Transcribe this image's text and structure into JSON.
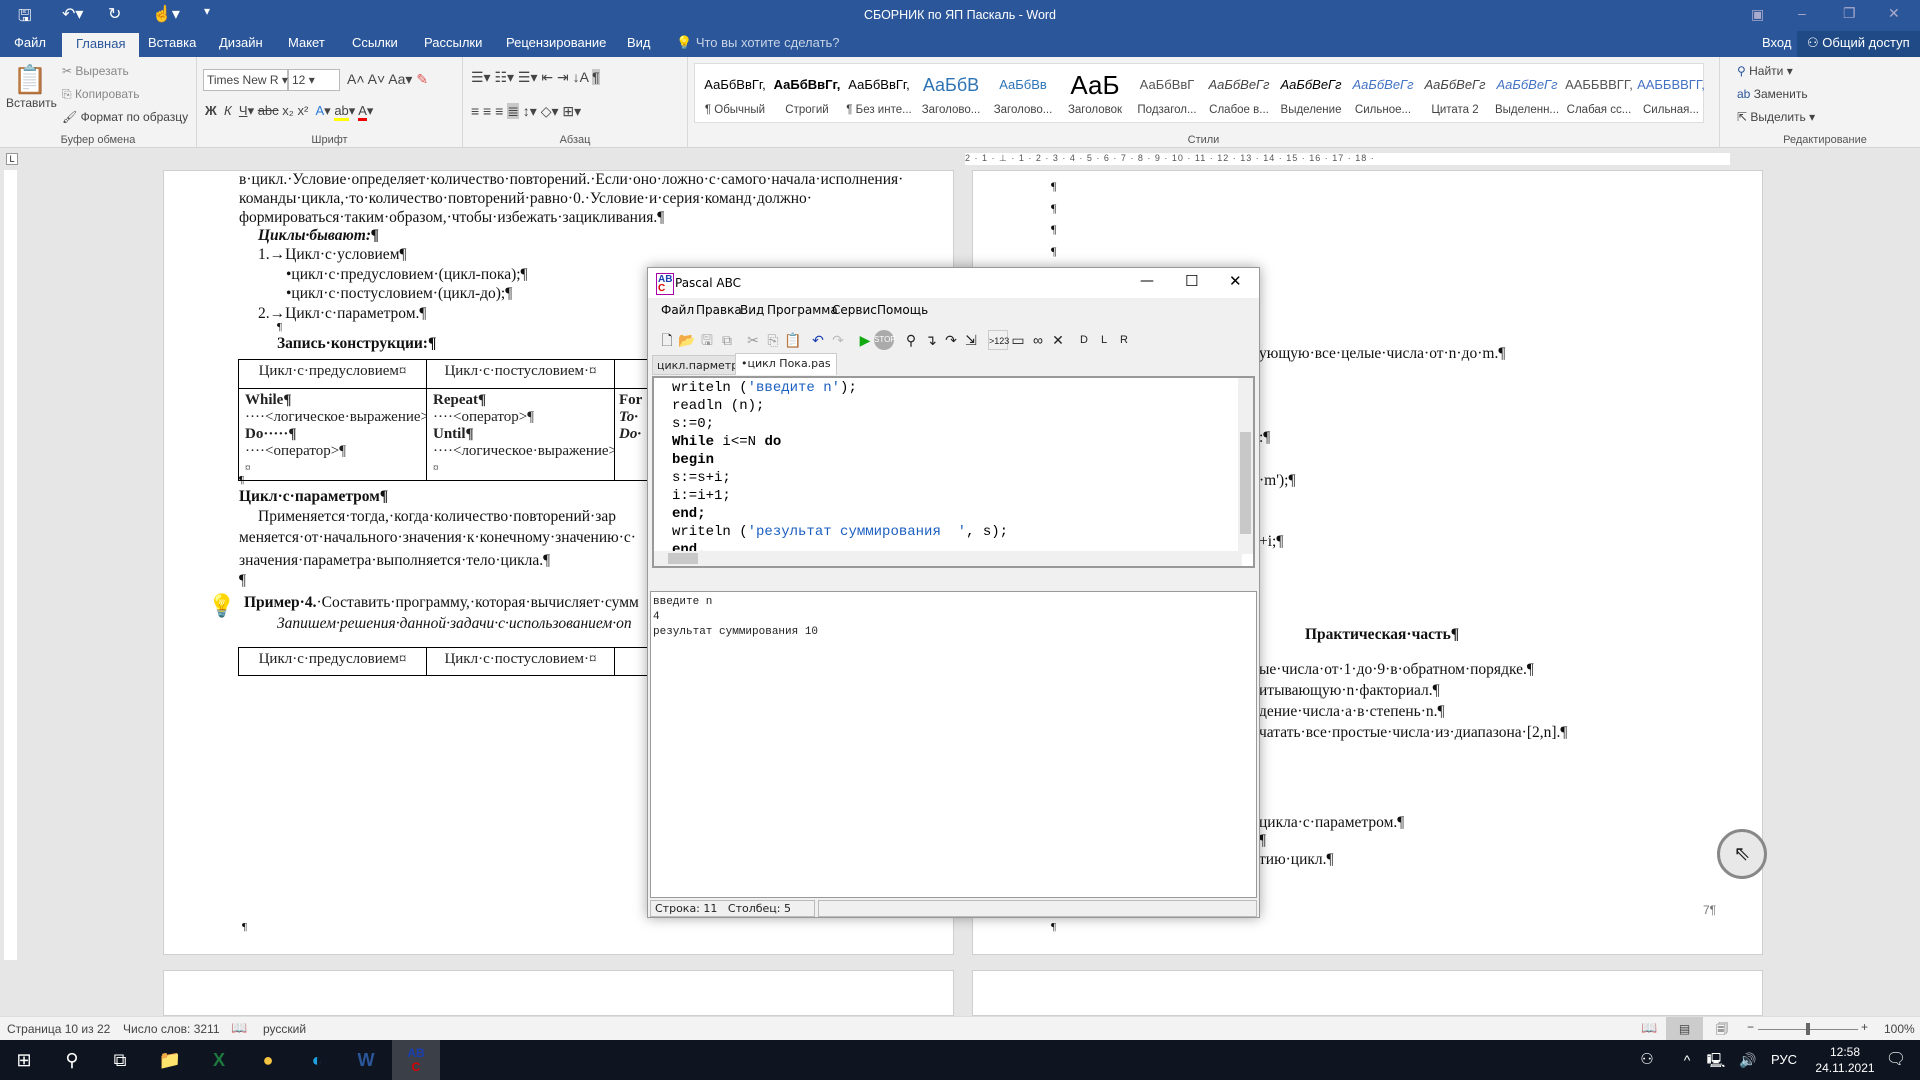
{
  "window": {
    "title": "СБОРНИК по ЯП Паскаль - Word",
    "login": "Вход",
    "share": "Общий доступ"
  },
  "ribbon_tabs": [
    "Файл",
    "Главная",
    "Вставка",
    "Дизайн",
    "Макет",
    "Ссылки",
    "Рассылки",
    "Рецензирование",
    "Вид"
  ],
  "tell_me": "Что вы хотите сделать?",
  "clipboard": {
    "paste": "Вставить",
    "cut": "Вырезать",
    "copy": "Копировать",
    "format_painter": "Формат по образцу",
    "label": "Буфер обмена"
  },
  "font": {
    "name": "Times New R",
    "size": "12",
    "label": "Шрифт",
    "bold": "Ж",
    "italic": "К",
    "underline": "Ч"
  },
  "paragraph": {
    "label": "Абзац"
  },
  "styles": {
    "label": "Стили",
    "items": [
      {
        "preview": "АаБбВвГг,",
        "name": "¶ Обычный"
      },
      {
        "preview": "АаБбВвГг,",
        "name": "Строгий"
      },
      {
        "preview": "АаБбВвГг,",
        "name": "¶ Без инте..."
      },
      {
        "preview": "АаБбВ",
        "name": "Заголово..."
      },
      {
        "preview": "АаБбВв",
        "name": "Заголово..."
      },
      {
        "preview": "АаБ",
        "name": "Заголовок"
      },
      {
        "preview": "АаБбВвГ",
        "name": "Подзагол..."
      },
      {
        "preview": "АаБбВеГг",
        "name": "Слабое в..."
      },
      {
        "preview": "АаБбВеГг",
        "name": "Выделение"
      },
      {
        "preview": "АаБбВеГг",
        "name": "Сильное..."
      },
      {
        "preview": "АаБбВеГг",
        "name": "Цитата 2"
      },
      {
        "preview": "АаБбВеГг",
        "name": "Выделенн..."
      },
      {
        "preview": "ААББВВГГ,",
        "name": "Слабая сс..."
      },
      {
        "preview": "ААББВВГГ,",
        "name": "Сильная..."
      }
    ]
  },
  "editing": {
    "find": "Найти",
    "replace": "Заменить",
    "select": "Выделить",
    "label": "Редактирование"
  },
  "ruler_text": "2 · 1 · ⊥ · 1 · 2 · 3 · 4 · 5 · 6 · 7 · 8 · 9 · 10 · 11 · 12 · 13 · 14 · 15 · 16 · 17 · 18 ·",
  "left_page": {
    "lines": [
      "в·цикл.·Условие·определяет·количество·повторений.·Если·оно·ложно·с·самого·начала·исполнения·",
      "команды·цикла,·то·количество·повторений·равно·0.·Условие·и·серия·команд·должно·",
      "формироваться·таким·образом,·чтобы·избежать·зацикливания.¶"
    ],
    "cycles_heading": "Циклы·бывают:¶",
    "list": [
      "1.→Цикл·с·условием¶",
      "•цикл·с·предусловием·(цикл-пока);¶",
      "•цикл·с·постусловием·(цикл-до);¶",
      "2.→Цикл·с·параметром.¶",
      "¶"
    ],
    "record_heading": "Запись·конструкции:¶",
    "table_headers": [
      "Цикл·с·предусловием¤",
      "Цикл·с·постусловием·¤"
    ],
    "col1": [
      "While¶",
      "····<логическое·выражение>·¶",
      "Do·····¶",
      "····<оператор>¶",
      "¤"
    ],
    "col2": [
      "Repeat¶",
      "····<оператор>¶",
      "Until¶",
      "····<логическое·выражение>¶",
      "¤"
    ],
    "col3": [
      "For",
      "To·",
      "Do·"
    ],
    "pilcrow": "¶",
    "param_heading": "Цикл·с·параметром¶",
    "param_lines": [
      "Применяется·тогда,·когда·количество·повторений·зар",
      "меняется·от·начального·значения·к·конечному·значению·с·",
      "значения·параметра·выполняется·тело·цикла.¶"
    ],
    "example_bold": "Пример·4.",
    "example_text": "·Составить·программу,·которая·вычисляет·сумм",
    "example_italic": "Запишем·решения·данной·задачи·с·использованием·оп",
    "table2_headers": [
      "Цикл·с·предусловием¤",
      "Цикл·с·постусловием·¤"
    ]
  },
  "right_page": {
    "pilcrow": "¶",
    "l1": "ующую·все·целые·числа·от·n·до·m.¶",
    "l2": ":¶",
    "l3": "·m');¶",
    "l4": "+i;¶",
    "practical": "Практическая·часть¶",
    "tasks": [
      "ые·числа·от·1·до·9·в·обратном·порядке.¶",
      "итывающую·n·факториал.¶",
      "дение·числа·a·в·степень·n.¶",
      "чатать·все·простые·числа·из·диапазона·[2,n].¶"
    ],
    "l5": "цикла·с·параметром.¶",
    "l6": "¶",
    "l7": "тию·цикл.¶",
    "page_num": "7¶"
  },
  "pascal": {
    "title": "Pascal ABC",
    "menu": [
      "Файл",
      "Правка",
      "Вид",
      "Программа",
      "Сервис",
      "Помощь"
    ],
    "tabs": [
      "цикл.парметр.pas",
      "•цикл Пока.pas"
    ],
    "code": [
      [
        {
          "t": "writeln (",
          "c": ""
        },
        {
          "t": "'введите n'",
          "c": "str"
        },
        {
          "t": ");",
          "c": ""
        }
      ],
      [
        {
          "t": "readln (n);",
          "c": ""
        }
      ],
      [
        {
          "t": "s:=0;",
          "c": ""
        }
      ],
      [
        {
          "t": "While",
          "c": "kw"
        },
        {
          "t": " i<=N ",
          "c": ""
        },
        {
          "t": "do",
          "c": "kw"
        }
      ],
      [
        {
          "t": "begin",
          "c": "kw"
        }
      ],
      [
        {
          "t": "s:=s+i;",
          "c": ""
        }
      ],
      [
        {
          "t": "i:=i+1;",
          "c": ""
        }
      ],
      [
        {
          "t": "end;",
          "c": "kw"
        }
      ],
      [
        {
          "t": "writeln (",
          "c": ""
        },
        {
          "t": "'результат суммирования  '",
          "c": "str"
        },
        {
          "t": ", s);",
          "c": ""
        }
      ],
      [
        {
          "t": "end.",
          "c": "kw"
        }
      ]
    ],
    "output": [
      "введите n",
      "4",
      "результат суммирования  10"
    ],
    "status_row": "Строка: 11",
    "status_col": "Столбец: 5"
  },
  "statusbar": {
    "page": "Страница 10 из 22",
    "words": "Число слов: 3211",
    "language": "русский",
    "zoom": "100%",
    "zoom_level": 100
  },
  "taskbar": {
    "lang": "РУС",
    "time": "12:58",
    "date": "24.11.2021"
  },
  "colors": {
    "word_blue": "#2b579a",
    "pascal_string": "#1b5fc1",
    "taskbar": "#0f1520"
  }
}
